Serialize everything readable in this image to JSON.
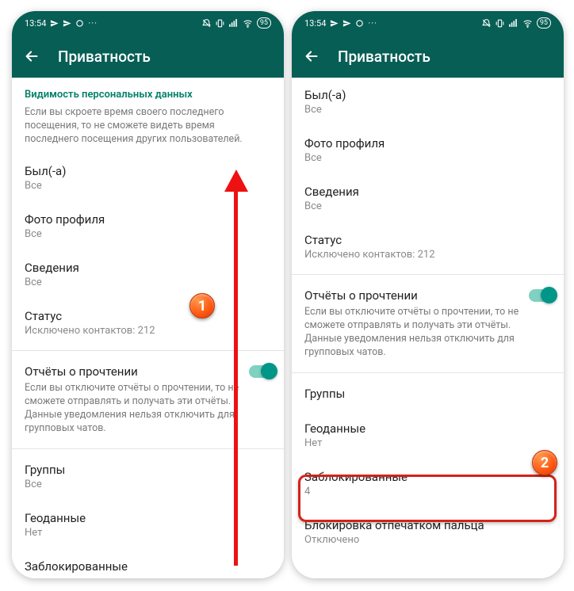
{
  "status": {
    "time": "13:54",
    "battery": "95"
  },
  "header": {
    "title": "Приватность"
  },
  "section": {
    "heading": "Видимость персональных данных",
    "description": "Если вы скроете время своего последнего посещения, то не сможете видеть время последнего посещения других пользователей."
  },
  "left": {
    "items": {
      "lastseen": {
        "label": "Был(-а)",
        "value": "Все"
      },
      "photo": {
        "label": "Фото профиля",
        "value": "Все"
      },
      "about": {
        "label": "Сведения",
        "value": "Все"
      },
      "status": {
        "label": "Статус",
        "value": "Исключено контактов: 212"
      },
      "readreceipts": {
        "label": "Отчёты о прочтении",
        "desc": "Если вы отключите отчёты о прочтении, то не сможете отправлять и получать эти отчёты. Данные уведомления нельзя отключить для групповых чатов."
      },
      "groups": {
        "label": "Группы",
        "value": "Все"
      },
      "geo": {
        "label": "Геоданные",
        "value": "Нет"
      },
      "blocked": {
        "label": "Заблокированные"
      }
    }
  },
  "right": {
    "items": {
      "lastseen": {
        "label": "Был(-а)",
        "value": "Все"
      },
      "photo": {
        "label": "Фото профиля",
        "value": "Все"
      },
      "about": {
        "label": "Сведения",
        "value": "Все"
      },
      "status": {
        "label": "Статус",
        "value": "Исключено контактов: 212"
      },
      "readreceipts": {
        "label": "Отчёты о прочтении",
        "desc": "Если вы отключите отчёты о прочтении, то не сможете отправлять и получать эти отчёты. Данные уведомления нельзя отключить для групповых чатов."
      },
      "groups": {
        "label": "Группы"
      },
      "geo": {
        "label": "Геоданные",
        "value": "Нет"
      },
      "blocked": {
        "label": "Заблокированные",
        "value": "4"
      },
      "fingerprint": {
        "label": "Блокировка отпечатком пальца",
        "value": "Отключено"
      }
    }
  },
  "badges": {
    "b1": "1",
    "b2": "2"
  }
}
